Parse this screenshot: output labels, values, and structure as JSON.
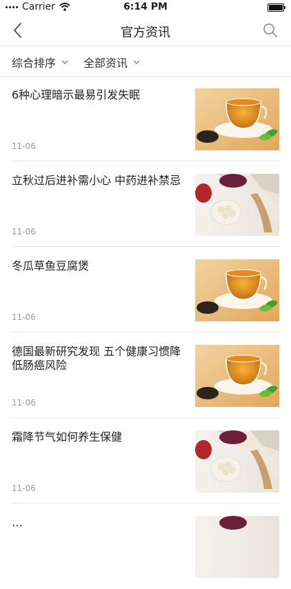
{
  "status": {
    "carrier": "Carrier",
    "time": "6:14 PM"
  },
  "nav": {
    "title": "官方资讯"
  },
  "filters": {
    "sort": "综合排序",
    "category": "全部资讯"
  },
  "articles": [
    {
      "title": "6种心理暗示最易引发失眠",
      "date": "11-06",
      "image": "tea-cup"
    },
    {
      "title": "立秋过后进补需小心 中药进补禁忌",
      "date": "11-06",
      "image": "herbs-fan"
    },
    {
      "title": "冬瓜草鱼豆腐煲",
      "date": "11-06",
      "image": "tea-cup"
    },
    {
      "title": "德国最新研究发现 五个健康习惯降低肠癌风险",
      "date": "11-06",
      "image": "tea-cup"
    },
    {
      "title": "霜降节气如何养生保健",
      "date": "11-06",
      "image": "herbs-fan"
    },
    {
      "title": "…",
      "date": "",
      "image": "herbs-fan"
    }
  ]
}
